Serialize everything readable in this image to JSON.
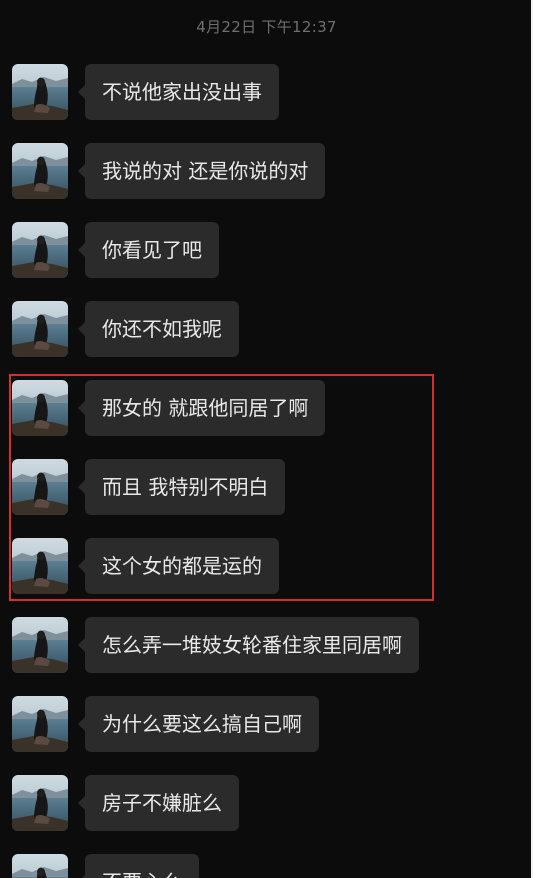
{
  "timestamp": "4月22日 下午12:37",
  "messages": [
    {
      "text": "不说他家出没出事",
      "avatar_icon": "woman-by-lake-avatar"
    },
    {
      "text": "我说的对 还是你说的对",
      "avatar_icon": "woman-by-lake-avatar"
    },
    {
      "text": "你看见了吧",
      "avatar_icon": "woman-by-lake-avatar"
    },
    {
      "text": "你还不如我呢",
      "avatar_icon": "woman-by-lake-avatar"
    },
    {
      "text": "那女的 就跟他同居了啊",
      "avatar_icon": "woman-by-lake-avatar"
    },
    {
      "text": "而且 我特别不明白",
      "avatar_icon": "woman-by-lake-avatar"
    },
    {
      "text": "这个女的都是运的",
      "avatar_icon": "woman-by-lake-avatar"
    },
    {
      "text": "怎么弄一堆妓女轮番住家里同居啊",
      "avatar_icon": "woman-by-lake-avatar"
    },
    {
      "text": "为什么要这么搞自己啊",
      "avatar_icon": "woman-by-lake-avatar"
    },
    {
      "text": "房子不嫌脏么",
      "avatar_icon": "woman-by-lake-avatar"
    },
    {
      "text": "不要心么",
      "avatar_icon": "woman-by-lake-avatar"
    }
  ],
  "colors": {
    "background": "#0c0c0c",
    "bubble": "#2b2b2b",
    "bubble_text": "#e9e9e9",
    "timestamp": "#6f6f6f",
    "highlight_border": "#d32f2f"
  }
}
